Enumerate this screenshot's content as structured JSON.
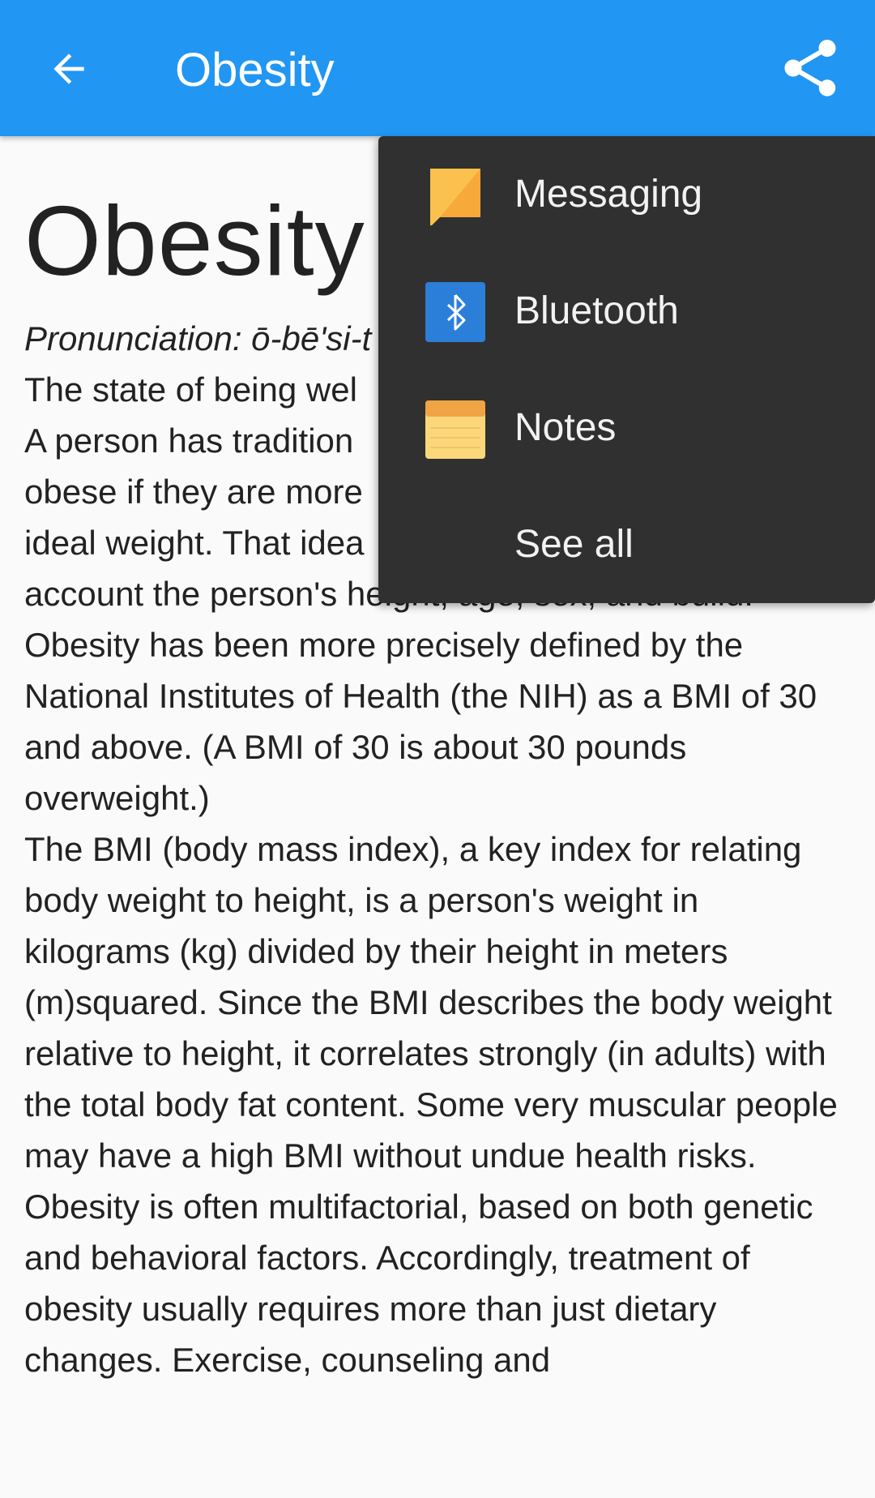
{
  "appbar": {
    "title": "Obesity",
    "back_icon": "arrow-left-icon",
    "share_icon": "share-icon"
  },
  "article": {
    "headword": "Obesity",
    "pronunciation": "Pronunciation: ō-bē'si-t",
    "paragraphs": [
      "The state of being wel",
      "A person has tradition",
      "obese if they are more",
      "ideal weight. That idea",
      "account the person's height, age, sex, and build.",
      "Obesity has been more precisely defined by the National Institutes of Health (the NIH) as a BMI of 30 and above. (A BMI of 30 is about 30 pounds overweight.)",
      "The BMI (body mass index), a key index for relating body weight to height, is a person's weight in kilograms (kg) divided by their height in meters (m)squared. Since the BMI describes the body weight relative to height, it correlates strongly (in adults) with the total body fat content. Some very muscular people may have a high BMI without undue health risks.",
      "Obesity is often multifactorial, based on both genetic and behavioral factors. Accordingly, treatment of obesity usually requires more than just dietary changes. Exercise, counseling and"
    ]
  },
  "share_menu": {
    "items": [
      {
        "label": "Messaging",
        "icon": "messaging-icon"
      },
      {
        "label": "Bluetooth",
        "icon": "bluetooth-icon"
      },
      {
        "label": "Notes",
        "icon": "notes-icon"
      },
      {
        "label": "See all",
        "icon": ""
      }
    ]
  },
  "colors": {
    "appbar": "#2196f3",
    "menu_bg": "#303030",
    "text": "#222222"
  }
}
